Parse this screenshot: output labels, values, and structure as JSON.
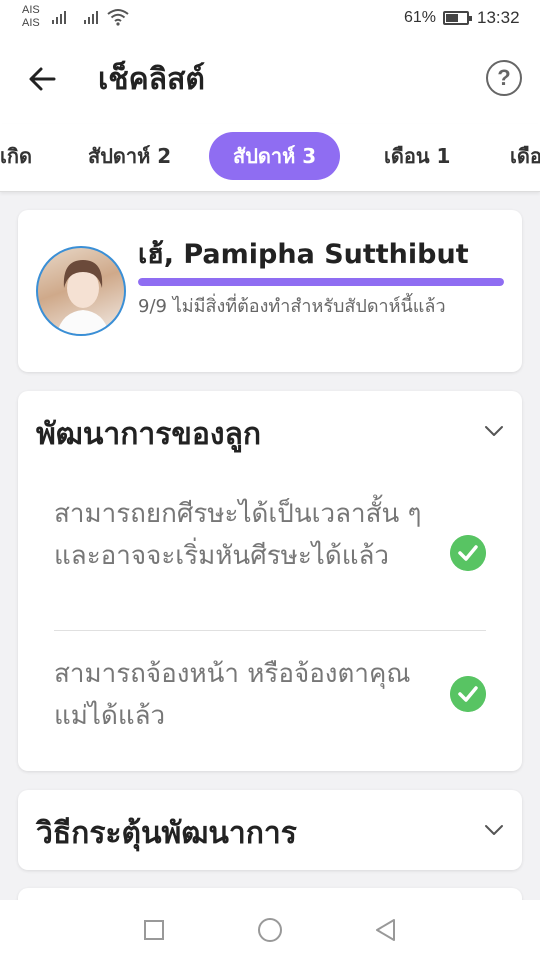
{
  "status_bar": {
    "carrier_1": "AIS",
    "carrier_2": "AIS",
    "battery_percent": "61%",
    "battery_level": 0.61,
    "time": "13:32"
  },
  "app_bar": {
    "title": "เช็คลิสต์",
    "back_icon": "arrow-left-icon",
    "help_icon": "help-icon",
    "help_glyph": "?"
  },
  "tabs": [
    {
      "label": "เกิด",
      "active": false
    },
    {
      "label": "สัปดาห์ 2",
      "active": false
    },
    {
      "label": "สัปดาห์ 3",
      "active": true
    },
    {
      "label": "เดือน 1",
      "active": false
    },
    {
      "label": "เดือ",
      "active": false
    }
  ],
  "profile": {
    "greeting": "เฮ้, Pamipha Sutthibut",
    "progress": 1.0,
    "summary": "9/9 ไม่มีสิ่งที่ต้องทำสำหรับสัปดาห์นี้แล้ว"
  },
  "development": {
    "title": "พัฒนาการของลูก",
    "expanded": true,
    "items": [
      {
        "text": "สามารถยกศีรษะได้เป็นเวลาสั้น ๆ และอาจจะเริ่มหันศีรษะได้แล้ว",
        "done": true
      },
      {
        "text": "สามารถจ้องหน้า หรือจ้องตาคุณแม่ได้แล้ว",
        "done": true
      }
    ]
  },
  "stimulation": {
    "title": "วิธีกระตุ้นพัฒนาการ",
    "expanded": false
  },
  "colors": {
    "accent": "#8f6df2",
    "check": "#58c463",
    "avatar_border": "#3a8fd6"
  },
  "nav_bar": {
    "icons": [
      "recent-apps-icon",
      "home-icon",
      "back-icon"
    ]
  }
}
